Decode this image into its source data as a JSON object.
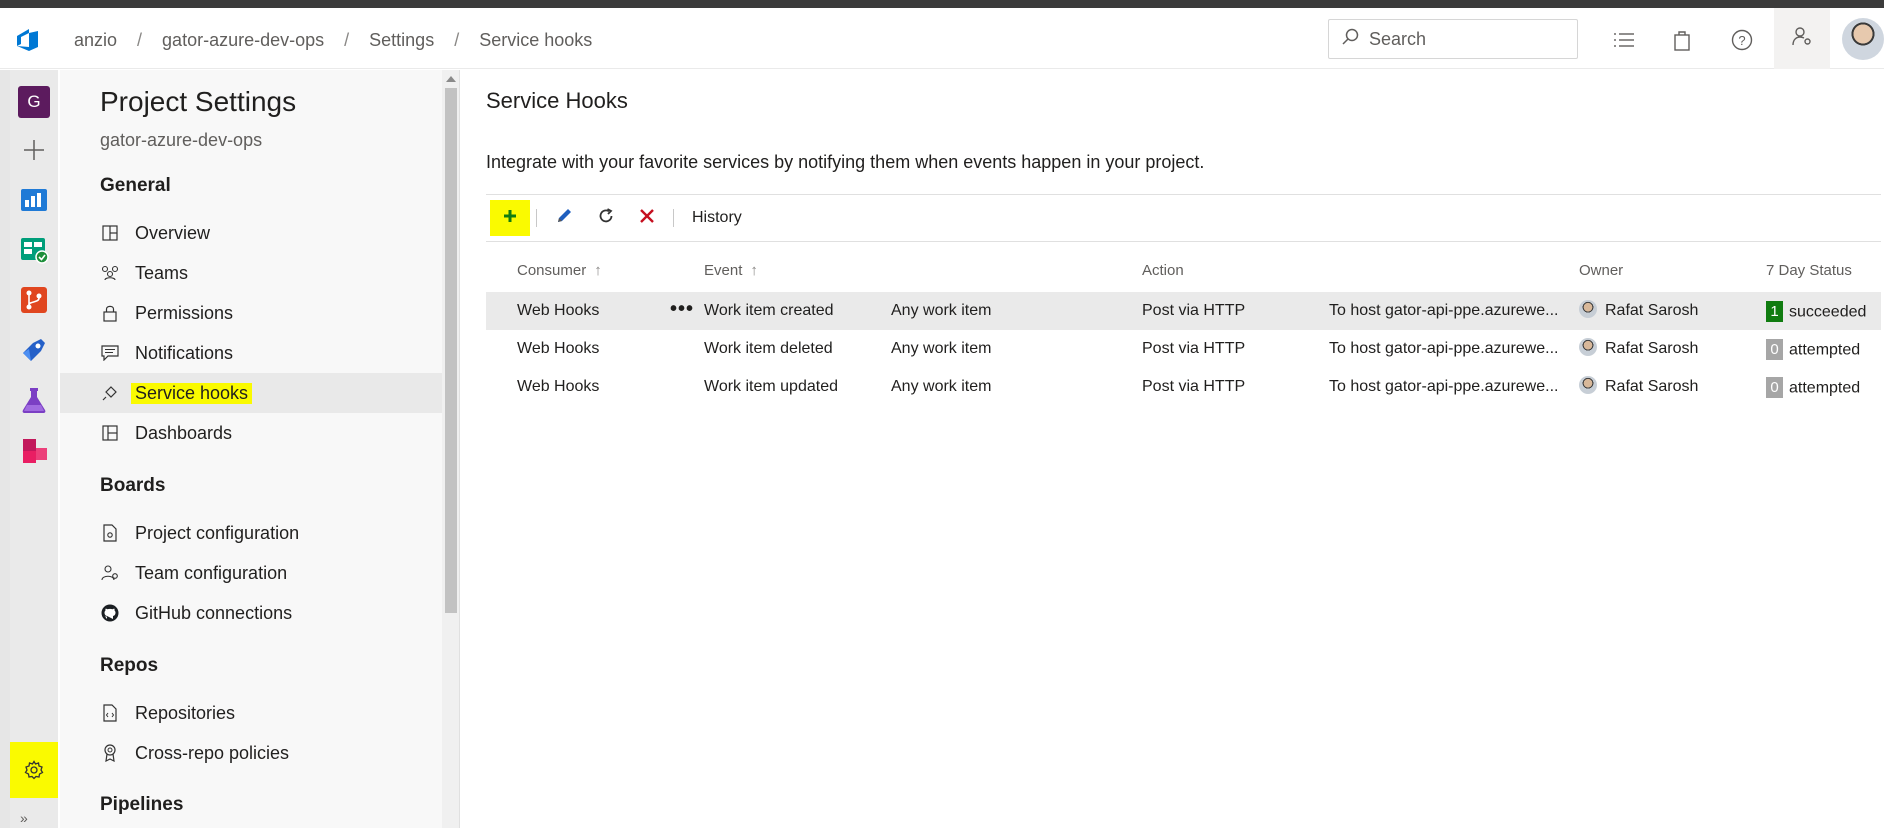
{
  "breadcrumb": [
    "anzio",
    "gator-azure-dev-ops",
    "Settings",
    "Service hooks"
  ],
  "search": {
    "placeholder": "Search"
  },
  "rail": {
    "org_initial": "G"
  },
  "settings_panel": {
    "title": "Project Settings",
    "project": "gator-azure-dev-ops",
    "sections": [
      {
        "label": "General",
        "items": [
          "Overview",
          "Teams",
          "Permissions",
          "Notifications",
          "Service hooks",
          "Dashboards"
        ]
      },
      {
        "label": "Boards",
        "items": [
          "Project configuration",
          "Team configuration",
          "GitHub connections"
        ]
      },
      {
        "label": "Repos",
        "items": [
          "Repositories",
          "Cross-repo policies"
        ]
      },
      {
        "label": "Pipelines",
        "items": []
      }
    ],
    "active_item": "Service hooks"
  },
  "main": {
    "title": "Service Hooks",
    "description": "Integrate with your favorite services by notifying them when events happen in your project.",
    "toolbar": {
      "history_label": "History"
    },
    "columns": {
      "consumer": "Consumer",
      "event": "Event",
      "action": "Action",
      "owner": "Owner",
      "status": "7 Day Status"
    },
    "rows": [
      {
        "consumer": "Web Hooks",
        "event": "Work item created",
        "filter": "Any work item",
        "action": "Post via HTTP",
        "target": "To host gator-api-ppe.azurewe...",
        "owner": "Rafat Sarosh",
        "count": "1",
        "status": "succeeded",
        "selected": true
      },
      {
        "consumer": "Web Hooks",
        "event": "Work item deleted",
        "filter": "Any work item",
        "action": "Post via HTTP",
        "target": "To host gator-api-ppe.azurewe...",
        "owner": "Rafat Sarosh",
        "count": "0",
        "status": "attempted",
        "selected": false
      },
      {
        "consumer": "Web Hooks",
        "event": "Work item updated",
        "filter": "Any work item",
        "action": "Post via HTTP",
        "target": "To host gator-api-ppe.azurewe...",
        "owner": "Rafat Sarosh",
        "count": "0",
        "status": "attempted",
        "selected": false
      }
    ]
  },
  "colors": {
    "success": "#107c10",
    "highlight": "#fafa00",
    "brand": "#0078d4",
    "org_tile": "#5c1b5e"
  }
}
